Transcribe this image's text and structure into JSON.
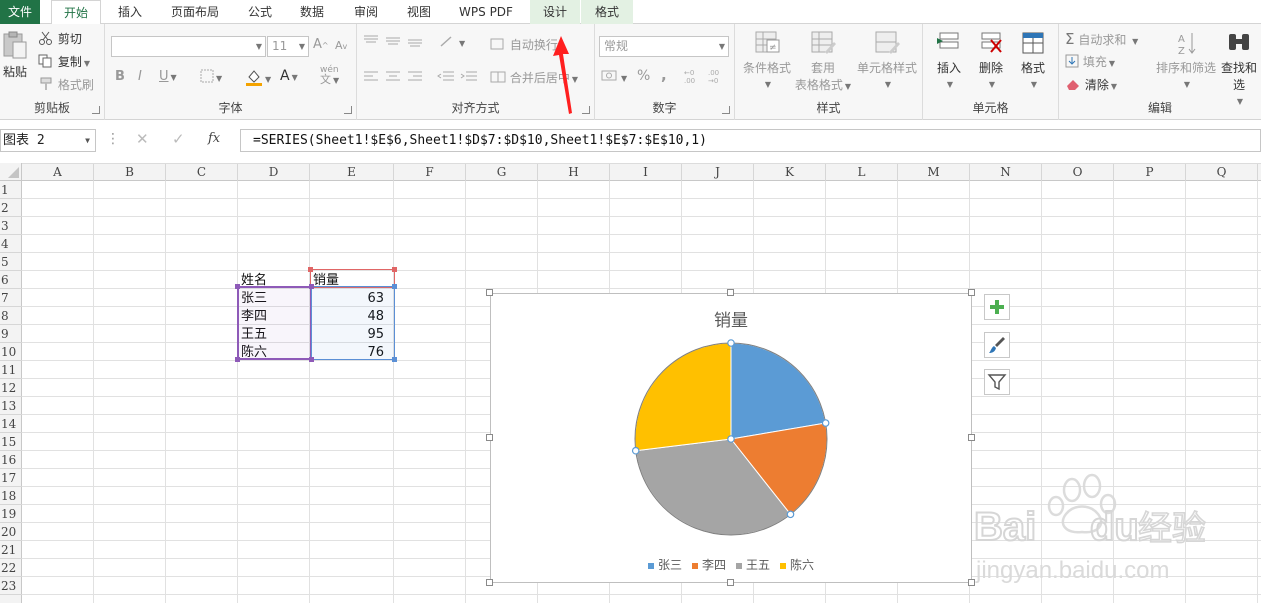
{
  "tabs": {
    "file": "文件",
    "home": "开始",
    "insert": "插入",
    "page_layout": "页面布局",
    "formulas": "公式",
    "data": "数据",
    "review": "审阅",
    "view": "视图",
    "wps_pdf": "WPS PDF",
    "design": "设计",
    "format": "格式"
  },
  "ribbon": {
    "clipboard": {
      "label": "剪贴板",
      "paste": "粘贴",
      "cut": "剪切",
      "copy": "复制",
      "format_painter": "格式刷"
    },
    "font": {
      "label": "字体",
      "size": "11",
      "bold": "B",
      "italic": "I",
      "underline": "U",
      "grow": "A",
      "shrink": "A",
      "color_a": "A",
      "phonetic": "wén"
    },
    "alignment": {
      "label": "对齐方式",
      "wrap": "自动换行",
      "merge": "合并后居中"
    },
    "number": {
      "label": "数字",
      "format": "常规",
      "percent": "%",
      "comma": ","
    },
    "styles": {
      "label": "样式",
      "conditional": "条件格式",
      "table_format_1": "套用",
      "table_format_2": "表格格式",
      "cell_styles": "单元格样式"
    },
    "cells": {
      "label": "单元格",
      "insert": "插入",
      "delete": "删除",
      "format": "格式"
    },
    "editing": {
      "label": "编辑",
      "autosum": "自动求和",
      "fill": "填充",
      "clear": "清除",
      "sort": "排序和筛选",
      "find": "查找和选"
    }
  },
  "formula_bar": {
    "name_box": "图表 2",
    "fx": "fx",
    "formula": "=SERIES(Sheet1!$E$6,Sheet1!$D$7:$D$10,Sheet1!$E$7:$E$10,1)"
  },
  "columns": [
    "A",
    "B",
    "C",
    "D",
    "E",
    "F",
    "G",
    "H",
    "I",
    "J",
    "K",
    "L",
    "M",
    "N",
    "O",
    "P",
    "Q"
  ],
  "rows": [
    "1",
    "2",
    "3",
    "4",
    "5",
    "6",
    "7",
    "8",
    "9",
    "10",
    "11",
    "12",
    "13",
    "14",
    "15",
    "16",
    "17",
    "18",
    "19",
    "20",
    "21",
    "22",
    "23"
  ],
  "sheet": {
    "header_name": "姓名",
    "header_sales": "销量",
    "names": [
      "张三",
      "李四",
      "王五",
      "陈六"
    ],
    "sales": [
      "63",
      "48",
      "95",
      "76"
    ]
  },
  "chart_data": {
    "type": "pie",
    "title": "销量",
    "categories": [
      "张三",
      "李四",
      "王五",
      "陈六"
    ],
    "values": [
      63,
      48,
      95,
      76
    ],
    "colors": [
      "#5b9bd5",
      "#ed7d31",
      "#a5a5a5",
      "#ffc000"
    ],
    "legend": "bottom"
  },
  "watermark": {
    "brand": "Baidu经验",
    "url": "jingyan.baidu.com"
  }
}
